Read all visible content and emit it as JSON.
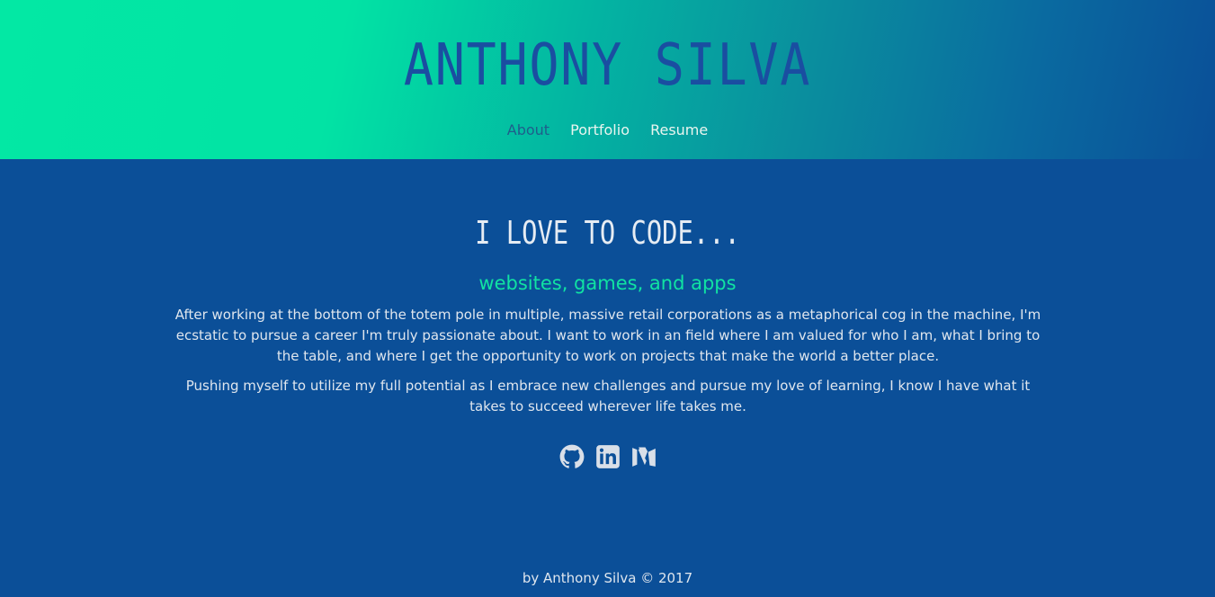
{
  "header": {
    "title": "ANTHONY SILVA",
    "nav": [
      {
        "label": "About"
      },
      {
        "label": "Portfolio"
      },
      {
        "label": "Resume"
      }
    ]
  },
  "main": {
    "heading": "I LOVE TO CODE...",
    "subheading": "websites, games, and apps",
    "paragraphs": [
      "After working at the bottom of the totem pole in multiple, massive retail corporations as a metaphorical cog in the machine, I'm ecstatic to pursue a career I'm truly passionate about. I want to work in an field where I am valued for who I am, what I bring to the table, and where I get the opportunity to work on projects that make the world a better place.",
      "Pushing myself to utilize my full potential as I embrace new challenges and pursue my love of learning, I know I have what it takes to succeed wherever life takes me."
    ]
  },
  "socials": [
    {
      "icon": "github-icon"
    },
    {
      "icon": "linkedin-icon"
    },
    {
      "icon": "medium-icon"
    }
  ],
  "footer": {
    "text": "by Anthony Silva © 2017"
  },
  "colors": {
    "header_gradient_start": "#03e8a4",
    "header_gradient_end": "#0a4f98",
    "page_background": "#0b4f98",
    "title_color": "#1a4ea1",
    "accent_green": "#10e3a2",
    "text_light": "#dfe6ee",
    "nav_active": "#1f5e8b"
  }
}
